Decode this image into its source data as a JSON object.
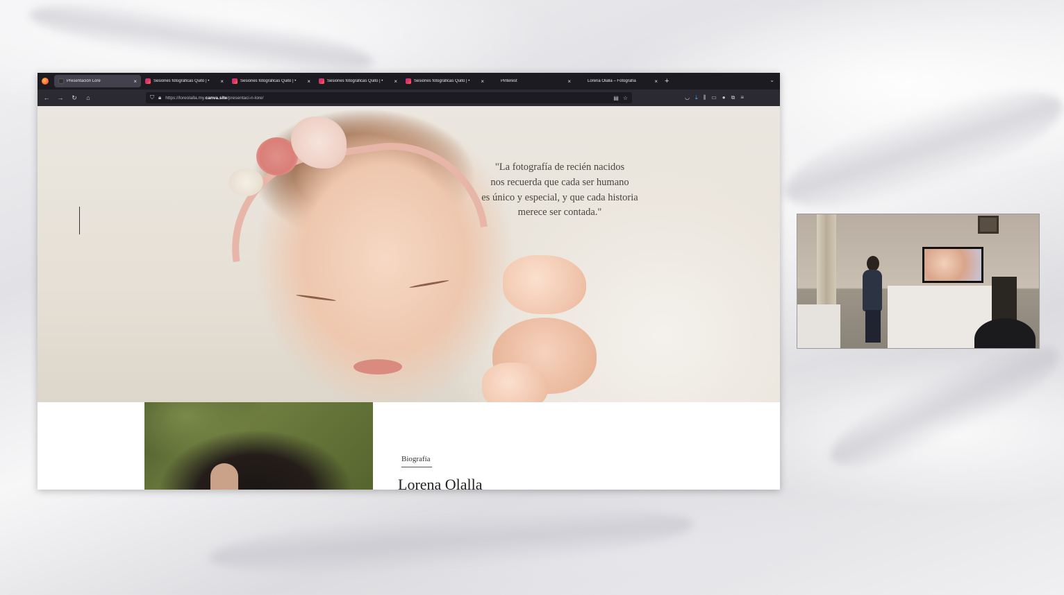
{
  "browser": {
    "tabs": [
      {
        "title": "Presentación Lore",
        "active": true,
        "favicon": "dark"
      },
      {
        "title": "Sesiones fotográficas Quito | •",
        "active": false,
        "favicon": "instagram"
      },
      {
        "title": "Sesiones fotográficas Quito | •",
        "active": false,
        "favicon": "instagram"
      },
      {
        "title": "Sesiones fotográficas Quito | •",
        "active": false,
        "favicon": "instagram"
      },
      {
        "title": "Sesiones fotográficas Quito | •",
        "active": false,
        "favicon": "instagram"
      },
      {
        "title": "Pinterest",
        "active": false,
        "favicon": "none"
      },
      {
        "title": "Lorena Olalla – Fotografía",
        "active": false,
        "favicon": "none"
      }
    ],
    "url": {
      "prefix": "https://loreolalla.my.",
      "domain": "canva.site",
      "path": "/presentaci-n-lore/"
    },
    "new_tab_symbol": "+",
    "close_symbol": "×"
  },
  "hero": {
    "quote_lines": [
      "\"La fotografía de recién nacidos",
      "nos recuerda que cada ser humano",
      "es único y especial, y que cada historia",
      "merece ser contada.\""
    ]
  },
  "bio": {
    "label": "Biografía",
    "name": "Lorena Olalla"
  },
  "icons": {
    "back": "arrow-left-icon",
    "forward": "arrow-right-icon",
    "reload": "reload-icon",
    "home": "home-icon",
    "shield": "shield-icon",
    "lock": "lock-icon",
    "bookmark": "star-icon"
  }
}
